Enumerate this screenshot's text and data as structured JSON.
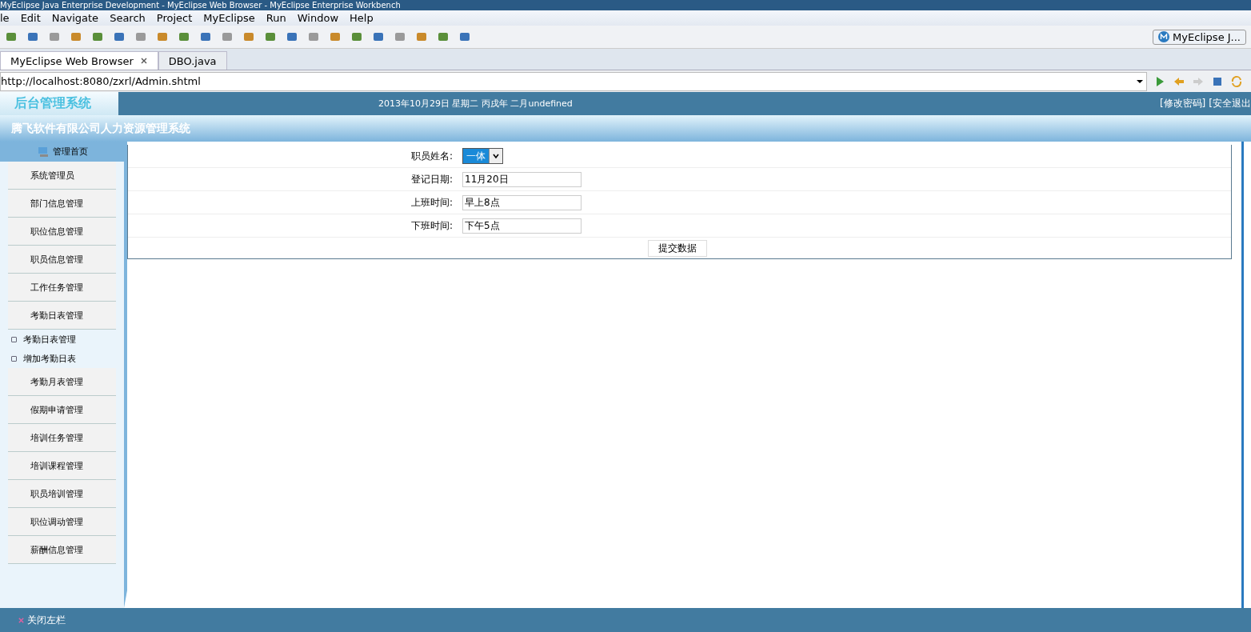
{
  "window": {
    "title": "MyEclipse Java Enterprise Development - MyEclipse Web Browser - MyEclipse Enterprise Workbench"
  },
  "menu": [
    "le",
    "Edit",
    "Navigate",
    "Search",
    "Project",
    "MyEclipse",
    "Run",
    "Window",
    "Help"
  ],
  "perspective": {
    "label": "MyEclipse J..."
  },
  "tabs": [
    {
      "label": "MyEclipse Web Browser",
      "selected": true
    },
    {
      "label": "DBO.java",
      "selected": false
    }
  ],
  "address": {
    "value": "http://localhost:8080/zxrl/Admin.shtml"
  },
  "app": {
    "logo": "后台管理系统",
    "date": "2013年10月29日 星期二 丙戌年 二月undefined",
    "links": [
      "[修改密码]",
      "[安全退出"
    ],
    "subtitle": "腾飞软件有限公司人力资源管理系统"
  },
  "sidebar": {
    "home": "管理首页",
    "items": [
      {
        "label": "系统管理员",
        "kind": "section"
      },
      {
        "label": "部门信息管理",
        "kind": "section"
      },
      {
        "label": "职位信息管理",
        "kind": "section"
      },
      {
        "label": "职员信息管理",
        "kind": "section"
      },
      {
        "label": "工作任务管理",
        "kind": "section"
      },
      {
        "label": "考勤日表管理",
        "kind": "section"
      },
      {
        "label": "考勤日表管理",
        "kind": "sub"
      },
      {
        "label": "增加考勤日表",
        "kind": "sub"
      },
      {
        "label": "考勤月表管理",
        "kind": "section"
      },
      {
        "label": "假期申请管理",
        "kind": "section"
      },
      {
        "label": "培训任务管理",
        "kind": "section"
      },
      {
        "label": "培训课程管理",
        "kind": "section"
      },
      {
        "label": "职员培训管理",
        "kind": "section"
      },
      {
        "label": "职位调动管理",
        "kind": "section"
      },
      {
        "label": "薪酬信息管理",
        "kind": "section"
      }
    ],
    "close": "关闭左栏"
  },
  "form": {
    "rows": [
      {
        "label": "职员姓名:",
        "kind": "select",
        "value": "一体"
      },
      {
        "label": "登记日期:",
        "kind": "input",
        "value": "11月20日"
      },
      {
        "label": "上班时间:",
        "kind": "input",
        "value": "早上8点"
      },
      {
        "label": "下班时间:",
        "kind": "input",
        "value": "下午5点"
      }
    ],
    "submit": "提交数据"
  }
}
